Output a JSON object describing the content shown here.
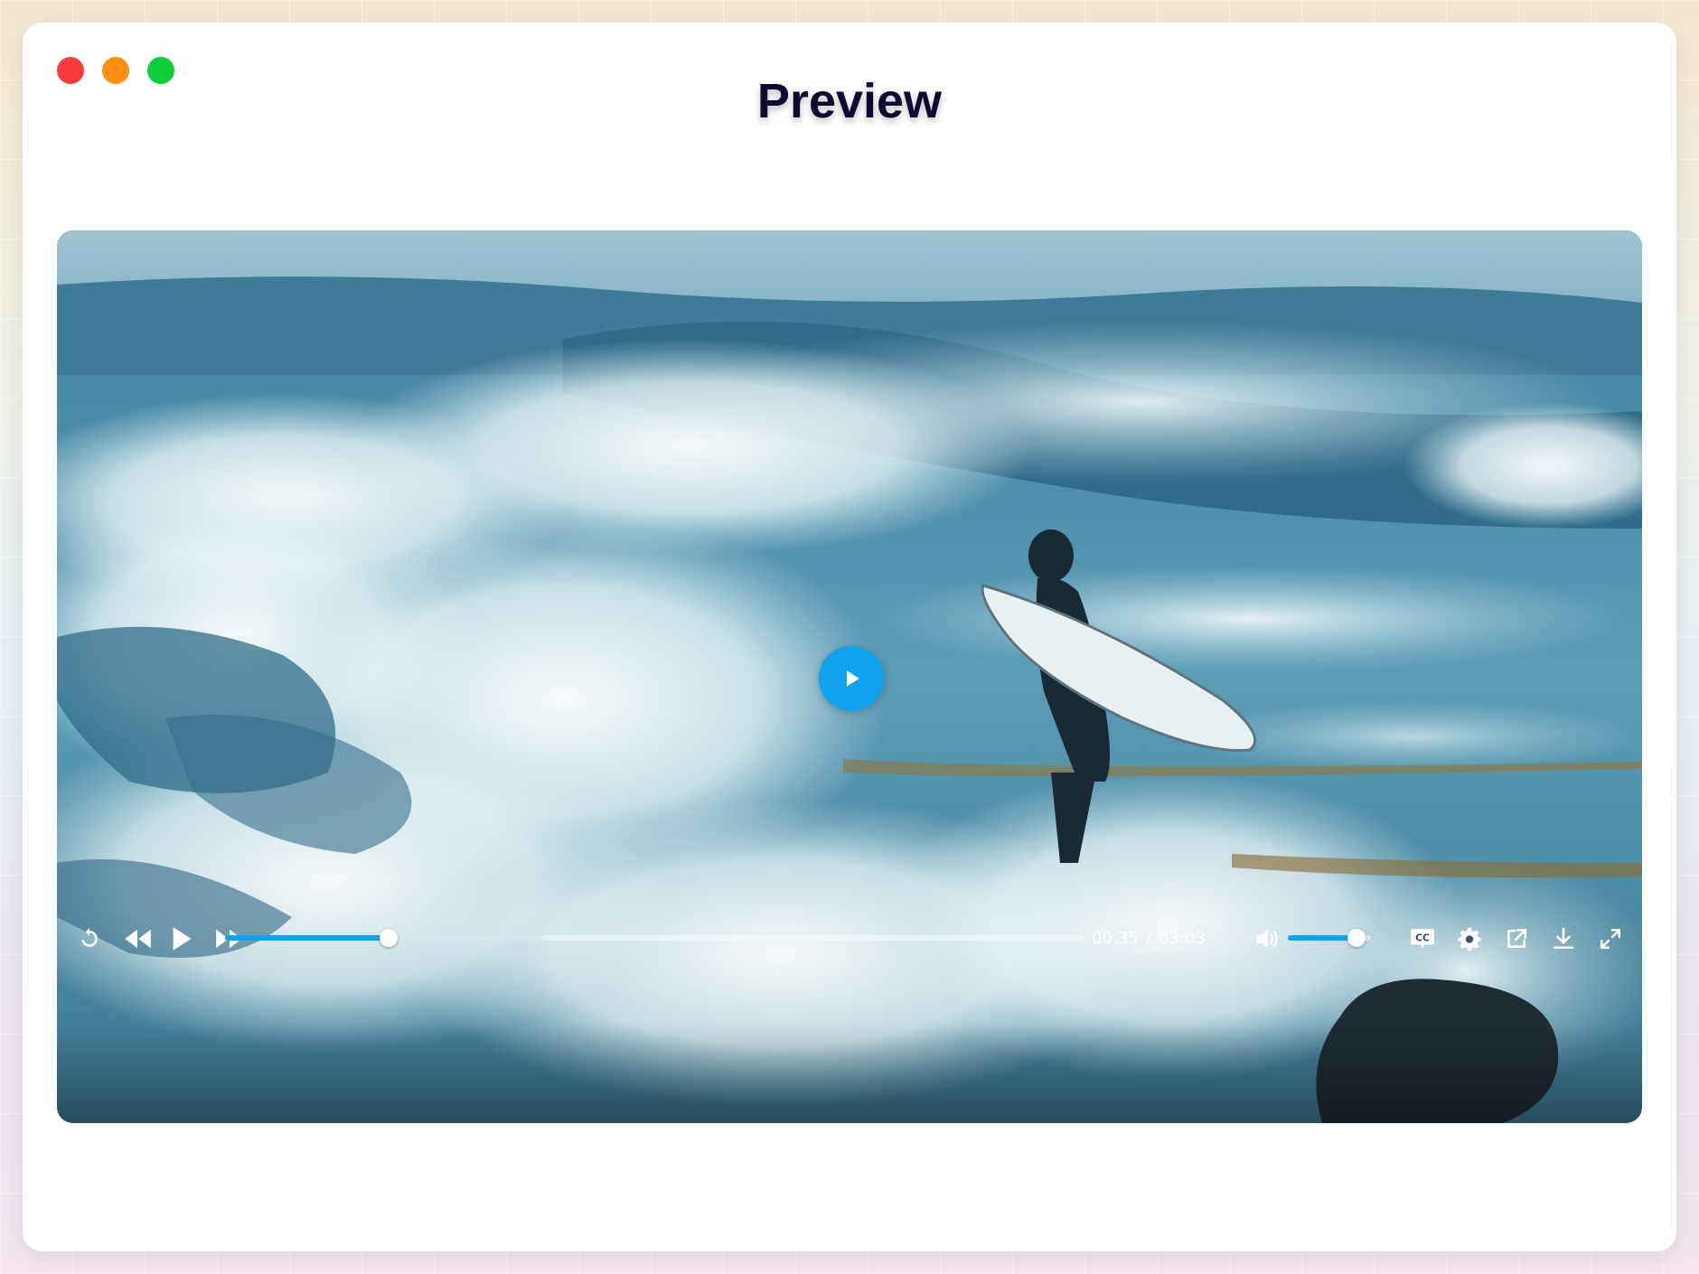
{
  "window": {
    "title": "Preview",
    "traffic_lights": [
      "close",
      "minimize",
      "maximize"
    ]
  },
  "colors": {
    "accent": "#0ea2ef",
    "close": "#fc3b3f",
    "minimize": "#fd8f13",
    "maximize": "#10cd3a",
    "title": "#0c0a2e"
  },
  "player": {
    "current_time": "00:35",
    "separator": "/",
    "duration": "03:03",
    "progress_fraction": 0.19,
    "buffered_fraction": 0.37,
    "volume_fraction": 0.83,
    "state": "paused",
    "controls": [
      {
        "name": "replay",
        "icon": "replay-icon"
      },
      {
        "name": "rewind",
        "icon": "rewind-icon"
      },
      {
        "name": "play",
        "icon": "play-icon"
      },
      {
        "name": "fast-forward",
        "icon": "fast-forward-icon"
      },
      {
        "name": "volume",
        "icon": "speaker-icon"
      },
      {
        "name": "captions",
        "icon": "cc-icon"
      },
      {
        "name": "settings",
        "icon": "gear-icon"
      },
      {
        "name": "pop-out",
        "icon": "external-link-icon"
      },
      {
        "name": "download",
        "icon": "download-icon"
      },
      {
        "name": "fullscreen",
        "icon": "fullscreen-icon"
      }
    ],
    "captions_label": "CC"
  }
}
